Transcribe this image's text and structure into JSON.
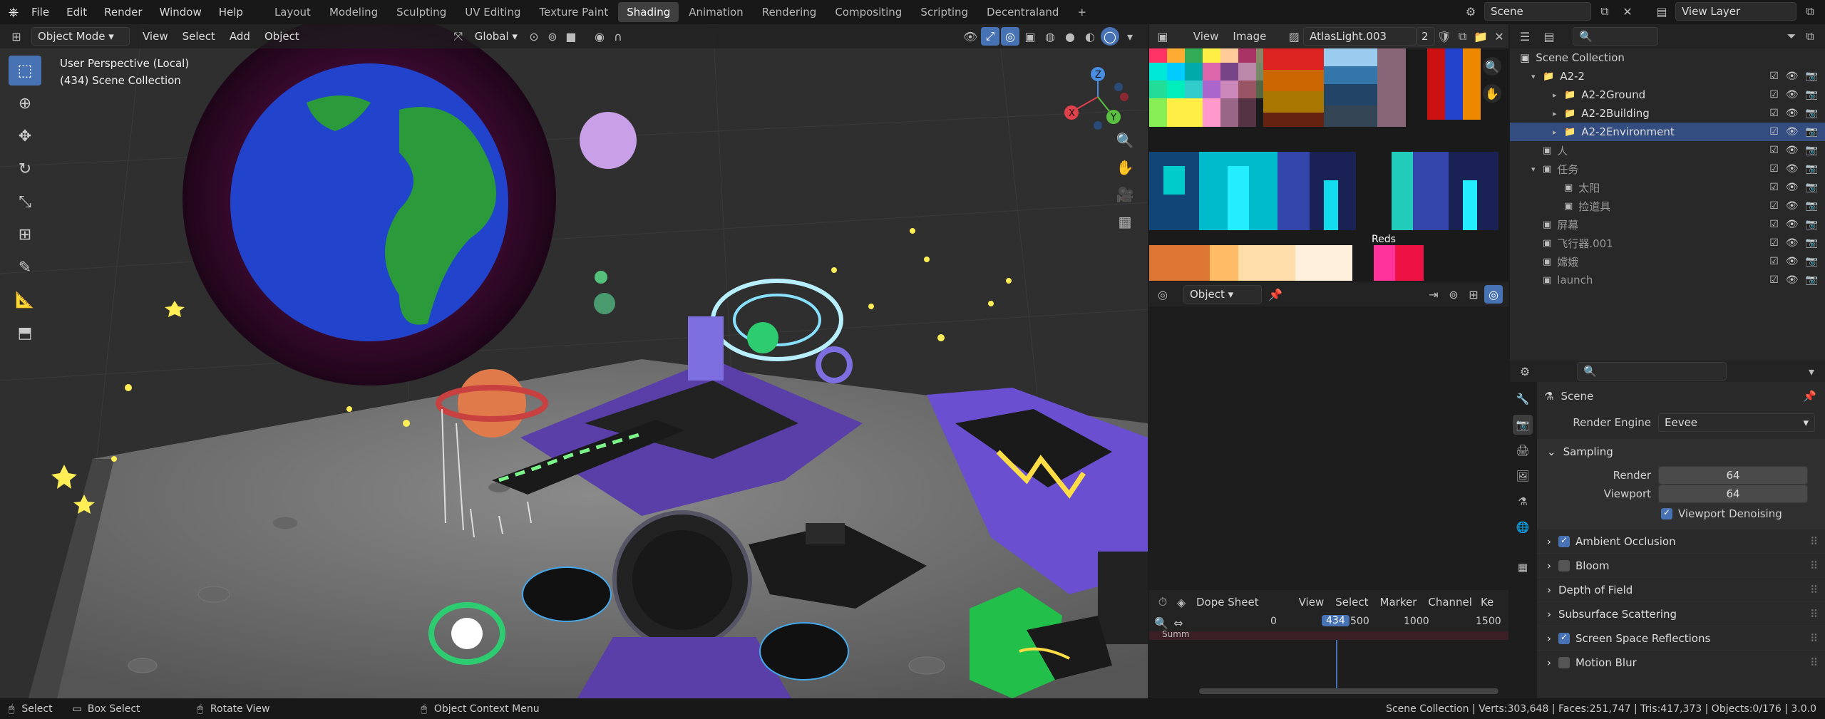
{
  "topbar": {
    "menus": [
      "File",
      "Edit",
      "Render",
      "Window",
      "Help"
    ],
    "workspaces": [
      "Layout",
      "Modeling",
      "Sculpting",
      "UV Editing",
      "Texture Paint",
      "Shading",
      "Animation",
      "Rendering",
      "Compositing",
      "Scripting",
      "Decentraland"
    ],
    "active_workspace": "Shading",
    "add_workspace": "+",
    "scene_name": "Scene",
    "view_layer": "View Layer"
  },
  "viewport": {
    "mode": "Object Mode",
    "menus": [
      "View",
      "Select",
      "Add",
      "Object"
    ],
    "transform_orientation": "Global",
    "overlay_title": "User Perspective (Local)",
    "overlay_subtitle": "(434) Scene Collection",
    "gizmo_axes": {
      "x": "X",
      "y": "Y",
      "z": "Z"
    }
  },
  "image_editor": {
    "menus": [
      "View",
      "Image"
    ],
    "image_name": "AtlasLight.003",
    "users": "2",
    "label_reds": "Reds"
  },
  "node_editor": {
    "object_type": "Object"
  },
  "dopesheet": {
    "mode": "Dope Sheet",
    "menus": [
      "View",
      "Select",
      "Marker",
      "Channel",
      "Ke"
    ],
    "ticks": [
      "0",
      "500",
      "1000",
      "1500"
    ],
    "current_frame": "434",
    "channel": "Summ"
  },
  "outliner": {
    "root": "Scene Collection",
    "rows": [
      {
        "label": "A2-2",
        "indent": 0
      },
      {
        "label": "A2-2Ground",
        "indent": 1
      },
      {
        "label": "A2-2Building",
        "indent": 1
      },
      {
        "label": "A2-2Environment",
        "indent": 1
      },
      {
        "label": "人",
        "indent": 0
      },
      {
        "label": "任务",
        "indent": 0
      },
      {
        "label": "太阳",
        "indent": 1
      },
      {
        "label": "捡道具",
        "indent": 1
      },
      {
        "label": "屏幕",
        "indent": 0
      },
      {
        "label": "飞行器.001",
        "indent": 0
      },
      {
        "label": "嫦娥",
        "indent": 0
      },
      {
        "label": "launch",
        "indent": 0
      }
    ]
  },
  "properties": {
    "context": "Scene",
    "render_engine_label": "Render Engine",
    "render_engine": "Eevee",
    "sampling_label": "Sampling",
    "render_label": "Render",
    "render_samples": "64",
    "viewport_label": "Viewport",
    "viewport_samples": "64",
    "denoise_label": "Viewport Denoising",
    "sections": [
      {
        "label": "Ambient Occlusion",
        "checked": true,
        "has_check": true
      },
      {
        "label": "Bloom",
        "checked": false,
        "has_check": true
      },
      {
        "label": "Depth of Field",
        "checked": false,
        "has_check": false
      },
      {
        "label": "Subsurface Scattering",
        "checked": false,
        "has_check": false
      },
      {
        "label": "Screen Space Reflections",
        "checked": true,
        "has_check": true
      },
      {
        "label": "Motion Blur",
        "checked": false,
        "has_check": true
      }
    ]
  },
  "statusbar": {
    "select": "Select",
    "box_select": "Box Select",
    "rotate_view": "Rotate View",
    "context_menu": "Object Context Menu",
    "stats": "Scene Collection | Verts:303,648 | Faces:251,747 | Tris:417,373 | Objects:0/176 | 3.0.0"
  },
  "colors": {
    "accent": "#4772b3",
    "selection": "#334d80",
    "playhead": "#4772b3"
  }
}
